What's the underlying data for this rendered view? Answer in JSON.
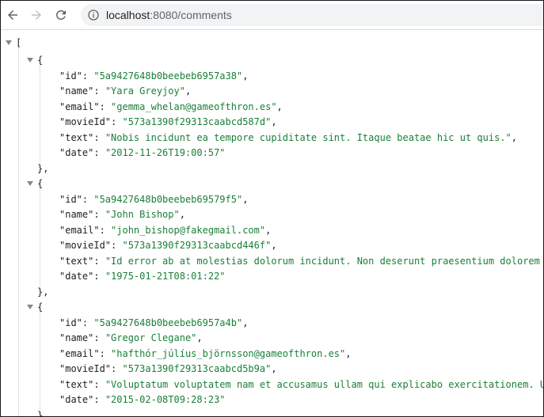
{
  "browser": {
    "url_host": "localhost",
    "url_rest": ":8080/comments",
    "icons": {
      "back": "arrow-left-icon",
      "forward": "arrow-right-icon",
      "reload": "reload-icon",
      "site_info": "info-icon"
    }
  },
  "json": {
    "open_bracket": "[",
    "open_brace": "{",
    "close_brace": "},",
    "records": [
      {
        "id": "\"5a9427648b0beebeb6957a38\"",
        "name": "\"Yara Greyjoy\"",
        "email": "\"gemma_whelan@gameofthron.es\"",
        "movieId": "\"573a1390f29313caabcd587d\"",
        "text": "\"Nobis incidunt ea tempore cupiditate sint. Itaque beatae hic ut quis.\"",
        "date": "\"2012-11-26T19:00:57\""
      },
      {
        "id": "\"5a9427648b0beebeb69579f5\"",
        "name": "\"John Bishop\"",
        "email": "\"john_bishop@fakegmail.com\"",
        "movieId": "\"573a1390f29313caabcd446f\"",
        "text": "\"Id error ab at molestias dolorum incidunt. Non deserunt praesentium dolorem n",
        "date": "\"1975-01-21T08:01:22\""
      },
      {
        "id": "\"5a9427648b0beebeb6957a4b\"",
        "name": "\"Gregor Clegane\"",
        "email": "\"hafthór_júlíus_björnsson@gameofthron.es\"",
        "movieId": "\"573a1390f29313caabcd5b9a\"",
        "text": "\"Voluptatum voluptatem nam et accusamus ullam qui explicabo exercitationem. Ut",
        "date": "\"2015-02-08T09:28:23\""
      }
    ],
    "keys": {
      "id": "\"id\"",
      "name": "\"name\"",
      "email": "\"email\"",
      "movieId": "\"movieId\"",
      "text": "\"text\"",
      "date": "\"date\""
    }
  }
}
